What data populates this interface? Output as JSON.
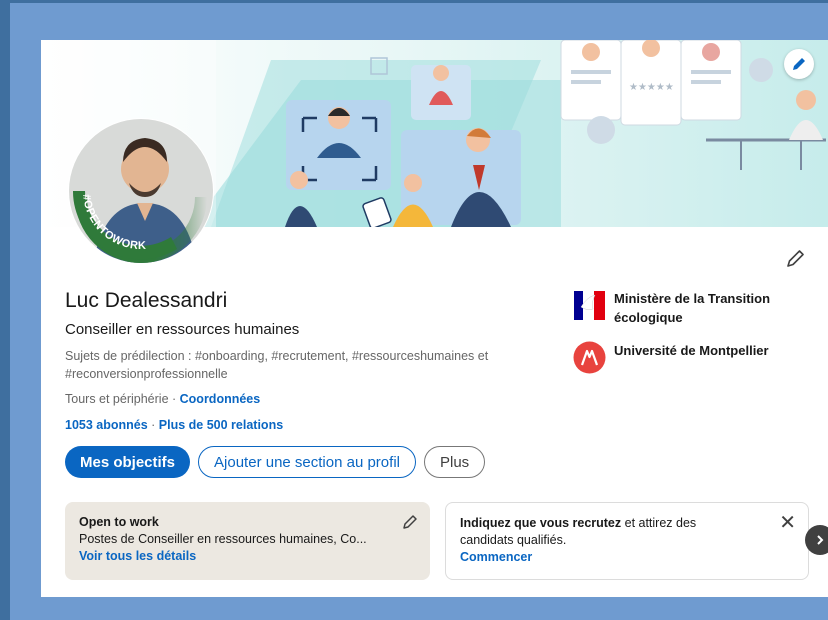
{
  "profile": {
    "name": "Luc Dealessandri",
    "headline": "Conseiller en ressources humaines",
    "topics": "Sujets de prédilection : #onboarding, #recrutement, #ressourceshumaines et #reconversionprofessionnelle",
    "location": "Tours et périphérie",
    "location_separator": " · ",
    "contact_link": "Coordonnées",
    "followers": "1053 abonnés",
    "links_separator": " · ",
    "connections": "Plus de 500 relations",
    "open_to_work_frame": "#OPENTOWORK"
  },
  "actions": {
    "primary": "Mes objectifs",
    "add_section": "Ajouter une section au profil",
    "more": "Plus"
  },
  "organizations": [
    {
      "name": "Ministère de la Transition écologique",
      "logo": "republique-francaise-icon"
    },
    {
      "name": "Université de Montpellier",
      "logo": "universite-montpellier-icon"
    }
  ],
  "open_to_work_box": {
    "title": "Open to work",
    "description": "Postes de Conseiller en ressources humaines, Co...",
    "link": "Voir tous les détails"
  },
  "recruiting_box": {
    "text_bold": "Indiquez que vous recrutez",
    "text_rest": " et attirez des candidats qualifiés.",
    "link": "Commencer",
    "close": "✕"
  },
  "icons": {
    "edit_cover": "pencil-icon",
    "edit_intro": "pencil-icon",
    "next": "chevron-right-icon"
  },
  "colors": {
    "accent": "#0a66c2",
    "open_to_work_green": "#2f7a3a",
    "page_background": "#6f9bd0",
    "open_to_work_bg": "#ece8e1"
  }
}
